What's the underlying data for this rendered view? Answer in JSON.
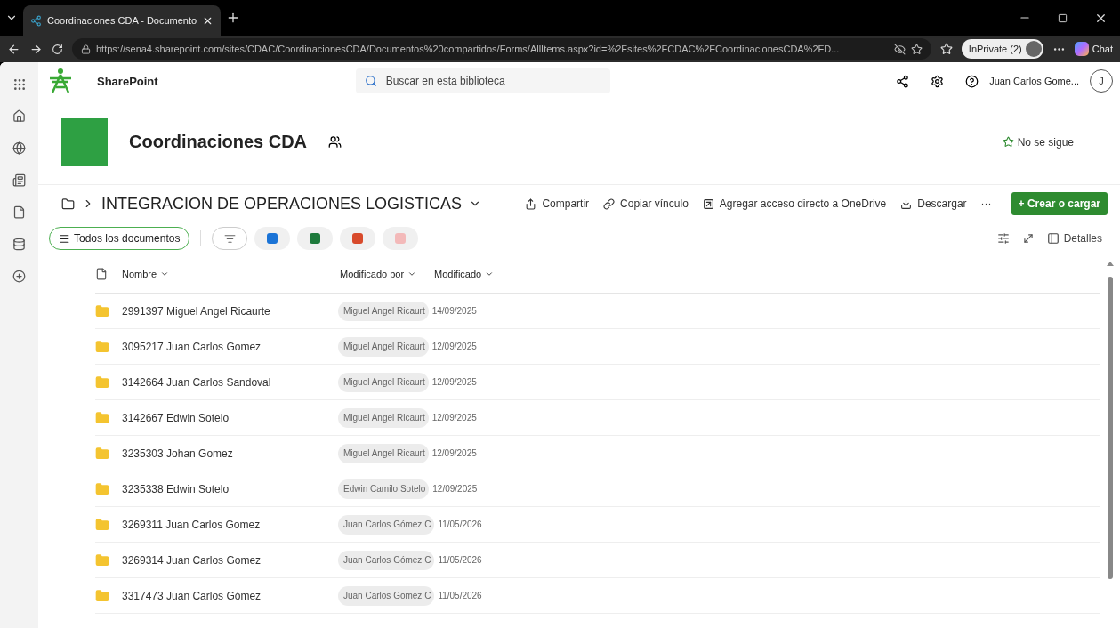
{
  "browser": {
    "tab_title": "Coordinaciones CDA - Documento",
    "url": "https://sena4.sharepoint.com/sites/CDAC/CoordinacionesCDA/Documentos%20compartidos/Forms/AllItems.aspx?id=%2Fsites%2FCDAC%2FCoordinacionesCDA%2FD...",
    "inprivate": "InPrivate (2)",
    "chat": "Chat"
  },
  "suite": {
    "app_name": "SharePoint",
    "search_placeholder": "Buscar en esta biblioteca",
    "user_name": "Juan Carlos Gome...",
    "user_initial": "J"
  },
  "site": {
    "title": "Coordinaciones CDA",
    "follow": "No se sigue"
  },
  "command_bar": {
    "breadcrumb": "INTEGRACION DE OPERACIONES LOGISTICAS",
    "actions": [
      {
        "kind": "share",
        "label": "Compartir"
      },
      {
        "kind": "link",
        "label": "Copiar vínculo"
      },
      {
        "kind": "shortcut",
        "label": "Agregar acceso directo a OneDrive"
      },
      {
        "kind": "download",
        "label": "Descargar"
      }
    ],
    "more": "···",
    "create": "+ Crear o cargar"
  },
  "view_bar": {
    "view": "Todos los documentos",
    "details": "Detalles"
  },
  "columns": [
    "Nombre",
    "Modificado por",
    "Modificado"
  ],
  "rows": [
    {
      "name": "2991397 Miguel Angel Ricaurte",
      "modified_by": "Miguel Angel Ricaurt",
      "modified": "14/09/2025"
    },
    {
      "name": "3095217 Juan Carlos Gomez",
      "modified_by": "Miguel Angel Ricaurt",
      "modified": "12/09/2025"
    },
    {
      "name": "3142664 Juan Carlos Sandoval",
      "modified_by": "Miguel Angel Ricaurt",
      "modified": "12/09/2025"
    },
    {
      "name": "3142667 Edwin Sotelo",
      "modified_by": "Miguel Angel Ricaurt",
      "modified": "12/09/2025"
    },
    {
      "name": "3235303 Johan Gomez",
      "modified_by": "Miguel Angel Ricaurt",
      "modified": "12/09/2025"
    },
    {
      "name": "3235338 Edwin Sotelo",
      "modified_by": "Edwin Camilo Sotelo",
      "modified": "12/09/2025"
    },
    {
      "name": "3269311 Juan Carlos Gomez",
      "modified_by": "Juan Carlos Gómez C",
      "modified": "11/05/2026"
    },
    {
      "name": "3269314 Juan Carlos Gomez",
      "modified_by": "Juan Carlos Gómez C",
      "modified": "11/05/2026"
    },
    {
      "name": "3317473 Juan Carlos Gómez",
      "modified_by": "Juan Carlos Gomez C",
      "modified": "11/05/2026"
    }
  ]
}
